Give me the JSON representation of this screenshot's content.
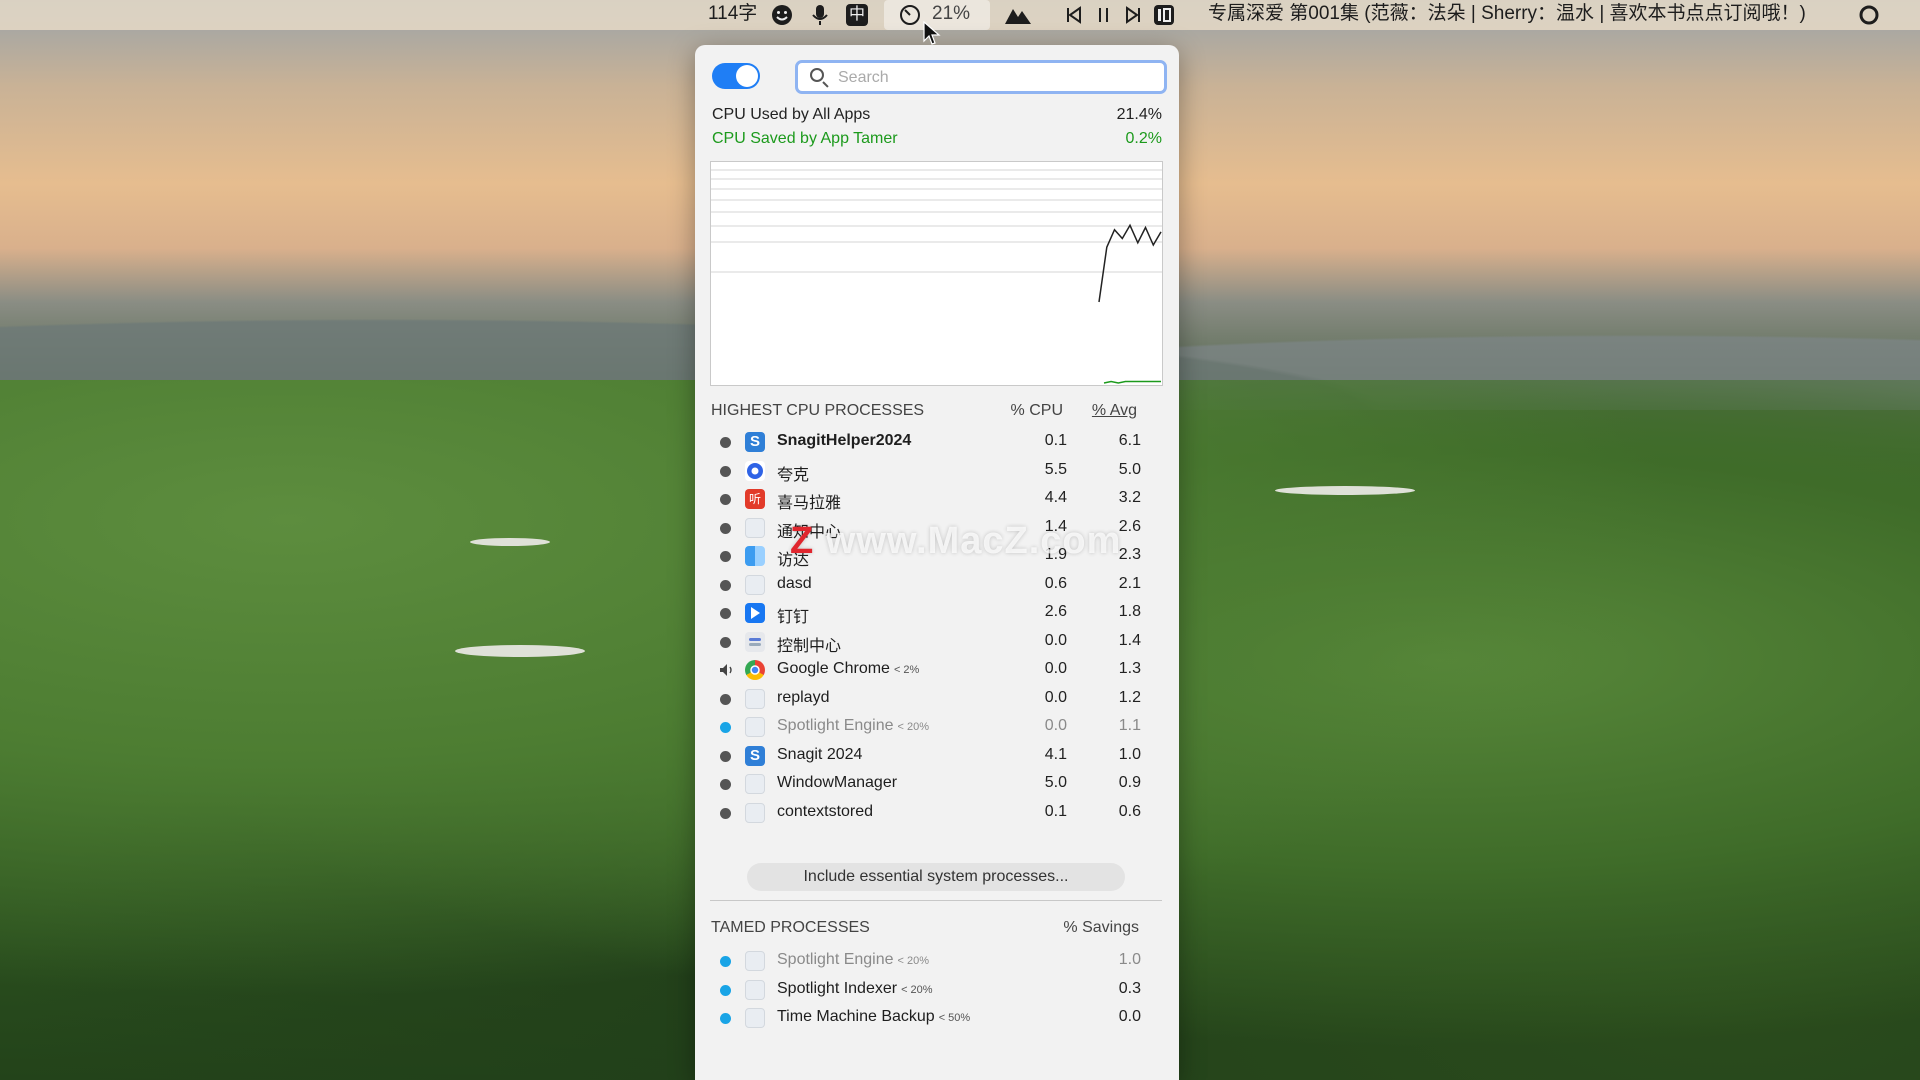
{
  "menubar": {
    "word_count": "114字",
    "ime": "中",
    "cpu_percent": "21%",
    "now_playing": "专属深爱 第001集 (范薇：法朵 | Sherry：温水 | 喜欢本书点点订阅哦！)",
    "icons": [
      "smiley-icon",
      "microphone-icon",
      "input-method-icon",
      "app-tamer-gauge-icon",
      "mountain-icon",
      "previous-track-icon",
      "pause-icon",
      "next-track-icon",
      "media-app-icon",
      "spotlight-circle-icon"
    ]
  },
  "panel": {
    "toggle_on": true,
    "search_placeholder": "Search",
    "cpu_used_label": "CPU Used by All Apps",
    "cpu_used_value": "21.4%",
    "cpu_saved_label": "CPU Saved by App Tamer",
    "cpu_saved_value": "0.2%",
    "graph_series": {
      "total_cpu_line": [
        0,
        62,
        70,
        66,
        72,
        64,
        71,
        63,
        69
      ],
      "saved_cpu_line": [
        0,
        1,
        0,
        1,
        1,
        1,
        1,
        1,
        1
      ]
    },
    "highest": {
      "title": "HIGHEST CPU PROCESSES",
      "col_cpu": "% CPU",
      "col_avg": "% Avg",
      "rows": [
        {
          "name": "SnagitHelper2024",
          "limit": "",
          "cpu": "0.1",
          "avg": "6.1",
          "icon": "snagit",
          "bold": true,
          "dim": false,
          "indicator": "dot"
        },
        {
          "name": "夸克",
          "limit": "",
          "cpu": "5.5",
          "avg": "5.0",
          "icon": "quark",
          "bold": false,
          "dim": false,
          "indicator": "dot"
        },
        {
          "name": "喜马拉雅",
          "limit": "",
          "cpu": "4.4",
          "avg": "3.2",
          "icon": "xmly",
          "bold": false,
          "dim": false,
          "indicator": "dot"
        },
        {
          "name": "通知中心",
          "limit": "",
          "cpu": "1.4",
          "avg": "2.6",
          "icon": "blank",
          "bold": false,
          "dim": false,
          "indicator": "dot"
        },
        {
          "name": "访达",
          "limit": "",
          "cpu": "1.9",
          "avg": "2.3",
          "icon": "finder",
          "bold": false,
          "dim": false,
          "indicator": "dot"
        },
        {
          "name": "dasd",
          "limit": "",
          "cpu": "0.6",
          "avg": "2.1",
          "icon": "blank",
          "bold": false,
          "dim": false,
          "indicator": "dot"
        },
        {
          "name": "钉钉",
          "limit": "",
          "cpu": "2.6",
          "avg": "1.8",
          "icon": "ding",
          "bold": false,
          "dim": false,
          "indicator": "dot"
        },
        {
          "name": "控制中心",
          "limit": "",
          "cpu": "0.0",
          "avg": "1.4",
          "icon": "cc",
          "bold": false,
          "dim": false,
          "indicator": "dot"
        },
        {
          "name": "Google Chrome",
          "limit": "< 2%",
          "cpu": "0.0",
          "avg": "1.3",
          "icon": "chrome",
          "bold": false,
          "dim": false,
          "indicator": "speaker"
        },
        {
          "name": "replayd",
          "limit": "",
          "cpu": "0.0",
          "avg": "1.2",
          "icon": "blank",
          "bold": false,
          "dim": false,
          "indicator": "dot"
        },
        {
          "name": "Spotlight Engine",
          "limit": "< 20%",
          "cpu": "0.0",
          "avg": "1.1",
          "icon": "blank",
          "bold": false,
          "dim": true,
          "indicator": "blue"
        },
        {
          "name": "Snagit 2024",
          "limit": "",
          "cpu": "4.1",
          "avg": "1.0",
          "icon": "snagit",
          "bold": false,
          "dim": false,
          "indicator": "dot"
        },
        {
          "name": "WindowManager",
          "limit": "",
          "cpu": "5.0",
          "avg": "0.9",
          "icon": "blank",
          "bold": false,
          "dim": false,
          "indicator": "dot"
        },
        {
          "name": "contextstored",
          "limit": "",
          "cpu": "0.1",
          "avg": "0.6",
          "icon": "blank",
          "bold": false,
          "dim": false,
          "indicator": "dot"
        }
      ]
    },
    "include_button": "Include essential system processes...",
    "tamed": {
      "title": "TAMED PROCESSES",
      "col_savings": "% Savings",
      "rows": [
        {
          "name": "Spotlight Engine",
          "limit": "< 20%",
          "savings": "1.0",
          "dim": true
        },
        {
          "name": "Spotlight Indexer",
          "limit": "< 20%",
          "savings": "0.3",
          "dim": false
        },
        {
          "name": "Time Machine Backup",
          "limit": "< 50%",
          "savings": "0.0",
          "dim": false
        }
      ]
    }
  },
  "watermark": {
    "z": "Z",
    "text": "www.MacZ.com"
  },
  "colors": {
    "accent": "#1f7ef5",
    "saved_green": "#1c9a1c",
    "tamed_blue": "#19a4e6"
  }
}
